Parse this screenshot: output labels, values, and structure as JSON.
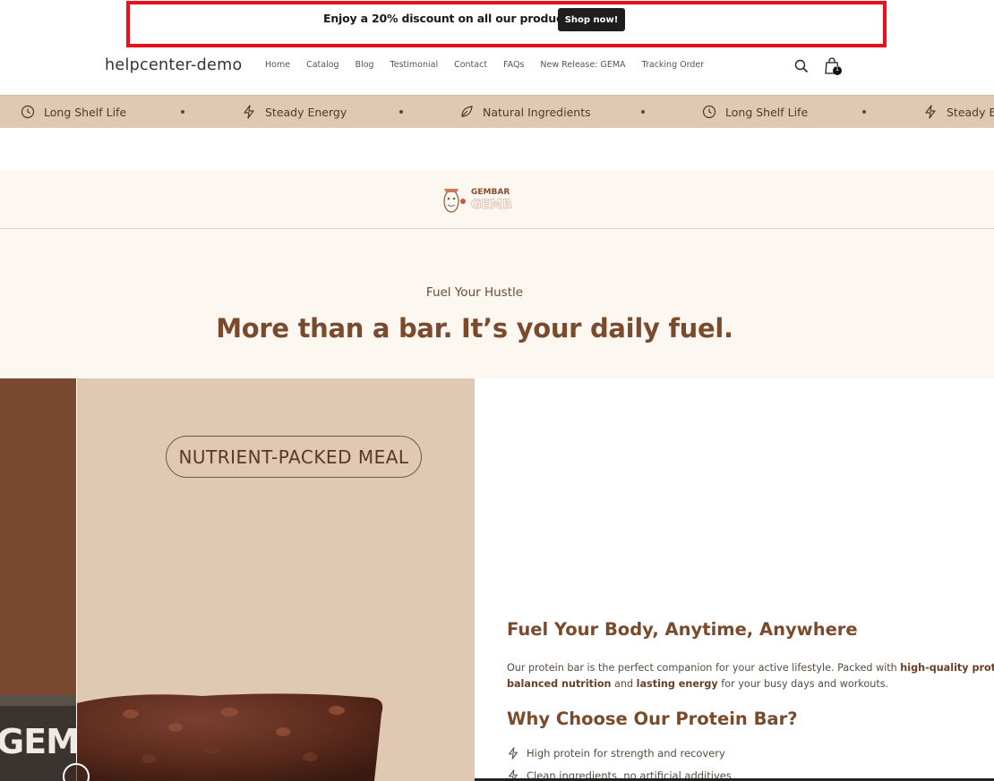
{
  "announcement": {
    "text": "Enjoy a 20% discount on all our products!",
    "button_label": "Shop now!"
  },
  "header": {
    "logo": "helpcenter-demo",
    "nav": [
      "Home",
      "Catalog",
      "Blog",
      "Testimonial",
      "Contact",
      "FAQs",
      "New Release: GEMA",
      "Tracking Order"
    ],
    "cart_count": "1",
    "icons": [
      "search-icon",
      "cart-icon"
    ]
  },
  "marquee": {
    "items": [
      {
        "label": "Long Shelf Life",
        "icon": "clock-icon"
      },
      {
        "label": "Steady Energy",
        "icon": "bolt-icon"
      },
      {
        "label": "Natural Ingredients",
        "icon": "leaf-icon"
      },
      {
        "label": "Long Shelf Life",
        "icon": "clock-icon"
      },
      {
        "label": "Steady E",
        "icon": "bolt-icon"
      }
    ]
  },
  "brand": {
    "name": "GEMBAR"
  },
  "hero": {
    "subtitle": "Fuel Your Hustle",
    "title": "More than a bar. It’s your daily fuel."
  },
  "image": {
    "pill_text": "NUTRIENT-PACKED MEAL",
    "package_text": "GEM"
  },
  "content": {
    "heading1": "Fuel Your Body, Anytime, Anywhere",
    "para_part1": "Our protein bar is the perfect companion for your active lifestyle. Packed with ",
    "para_bold1": "high-quality prote",
    "para_bold2": "balanced nutrition",
    "para_part2": " and ",
    "para_bold3": "lasting energy",
    "para_part3": " for your busy days and workouts.",
    "heading2": "Why Choose Our Protein Bar?",
    "bullets": [
      "High protein for strength and recovery",
      "Clean ingredients, no artificial additives"
    ]
  },
  "colors": {
    "accent": "#7a4a2c",
    "band": "#e0c9b2",
    "cream": "#fdf7f1",
    "highlight_outline": "#e8101a"
  }
}
